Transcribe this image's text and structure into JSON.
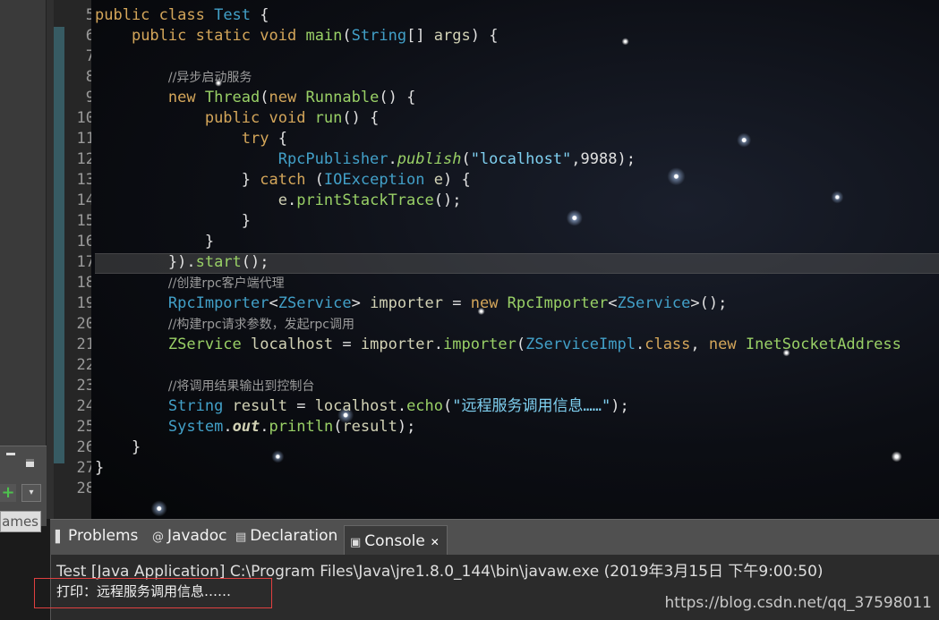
{
  "left_panel": {
    "names_tab": "ames"
  },
  "editor": {
    "line_numbers": [
      "5",
      "6",
      "7",
      "8",
      "9",
      "10",
      "11",
      "12",
      "13",
      "14",
      "15",
      "16",
      "17",
      "18",
      "19",
      "20",
      "21",
      "22",
      "23",
      "24",
      "25",
      "26",
      "27",
      "28"
    ],
    "lines": [
      [
        [
          "kw",
          "public "
        ],
        [
          "kw",
          "class "
        ],
        [
          "ty",
          "Test "
        ],
        [
          "p",
          "{"
        ]
      ],
      [
        [
          "p",
          "    "
        ],
        [
          "kw",
          "public "
        ],
        [
          "kw",
          "static "
        ],
        [
          "kw",
          "void "
        ],
        [
          "fn",
          "main"
        ],
        [
          "p",
          "("
        ],
        [
          "ty",
          "String"
        ],
        [
          "p",
          "[] "
        ],
        [
          "var",
          "args"
        ],
        [
          "p",
          ") {"
        ]
      ],
      [],
      [
        [
          "p",
          "        "
        ],
        [
          "cm",
          "//异步启动服务"
        ]
      ],
      [
        [
          "p",
          "        "
        ],
        [
          "kw",
          "new "
        ],
        [
          "cls",
          "Thread"
        ],
        [
          "p",
          "("
        ],
        [
          "kw",
          "new "
        ],
        [
          "cls",
          "Runnable"
        ],
        [
          "p",
          "() {"
        ]
      ],
      [
        [
          "p",
          "            "
        ],
        [
          "kw",
          "public "
        ],
        [
          "kw",
          "void "
        ],
        [
          "fn",
          "run"
        ],
        [
          "p",
          "() {"
        ]
      ],
      [
        [
          "p",
          "                "
        ],
        [
          "kw",
          "try "
        ],
        [
          "p",
          "{"
        ]
      ],
      [
        [
          "p",
          "                    "
        ],
        [
          "ty",
          "RpcPublisher"
        ],
        [
          "p",
          "."
        ],
        [
          "fn it",
          "publish"
        ],
        [
          "p",
          "("
        ],
        [
          "str",
          "\"localhost\""
        ],
        [
          "p",
          ",9988);"
        ]
      ],
      [
        [
          "p",
          "                "
        ],
        [
          "p",
          "} "
        ],
        [
          "kw",
          "catch "
        ],
        [
          "p",
          "("
        ],
        [
          "ty",
          "IOException "
        ],
        [
          "var",
          "e"
        ],
        [
          "p",
          ") {"
        ]
      ],
      [
        [
          "p",
          "                    "
        ],
        [
          "var",
          "e"
        ],
        [
          "p",
          "."
        ],
        [
          "fn",
          "printStackTrace"
        ],
        [
          "p",
          "();"
        ]
      ],
      [
        [
          "p",
          "                "
        ],
        [
          "p",
          "}"
        ]
      ],
      [
        [
          "p",
          "            "
        ],
        [
          "p",
          "}"
        ]
      ],
      [
        [
          "p",
          "        "
        ],
        [
          "p",
          "})."
        ],
        [
          "fn",
          "start"
        ],
        [
          "p",
          "();"
        ]
      ],
      [
        [
          "p",
          "        "
        ],
        [
          "cm",
          "//创建rpc客户端代理"
        ]
      ],
      [
        [
          "p",
          "        "
        ],
        [
          "ty",
          "RpcImporter"
        ],
        [
          "p",
          "<"
        ],
        [
          "ty",
          "ZService"
        ],
        [
          "p",
          "> "
        ],
        [
          "var",
          "importer "
        ],
        [
          "p",
          "= "
        ],
        [
          "kw",
          "new "
        ],
        [
          "cls",
          "RpcImporter"
        ],
        [
          "p",
          "<"
        ],
        [
          "ty",
          "ZService"
        ],
        [
          "p",
          ">();"
        ]
      ],
      [
        [
          "p",
          "        "
        ],
        [
          "cm",
          "//构建rpc请求参数，发起rpc调用"
        ]
      ],
      [
        [
          "p",
          "        "
        ],
        [
          "cls",
          "ZService "
        ],
        [
          "var",
          "localhost "
        ],
        [
          "p",
          "= "
        ],
        [
          "var",
          "importer"
        ],
        [
          "p",
          "."
        ],
        [
          "fn",
          "importer"
        ],
        [
          "p",
          "("
        ],
        [
          "ty",
          "ZServiceImpl"
        ],
        [
          "p",
          "."
        ],
        [
          "kw",
          "class"
        ],
        [
          "p",
          ", "
        ],
        [
          "kw",
          "new "
        ],
        [
          "cls",
          "InetSocketAddress"
        ]
      ],
      [],
      [
        [
          "p",
          "        "
        ],
        [
          "cm",
          "//将调用结果输出到控制台"
        ]
      ],
      [
        [
          "p",
          "        "
        ],
        [
          "ty",
          "String "
        ],
        [
          "var",
          "result "
        ],
        [
          "p",
          "= "
        ],
        [
          "var",
          "localhost"
        ],
        [
          "p",
          "."
        ],
        [
          "fn",
          "echo"
        ],
        [
          "p",
          "("
        ],
        [
          "str",
          "\"远程服务调用信息……\""
        ],
        [
          "p",
          ");"
        ]
      ],
      [
        [
          "p",
          "        "
        ],
        [
          "ty",
          "System"
        ],
        [
          "p",
          "."
        ],
        [
          "var it bold",
          "out"
        ],
        [
          "p",
          "."
        ],
        [
          "fn",
          "println"
        ],
        [
          "p",
          "("
        ],
        [
          "var",
          "result"
        ],
        [
          "p",
          ");"
        ]
      ],
      [
        [
          "p",
          "    "
        ],
        [
          "p",
          "}"
        ]
      ],
      [
        [
          "p",
          "}"
        ]
      ],
      []
    ]
  },
  "console": {
    "tabs": [
      {
        "icon": "problems-icon",
        "glyph": "▌",
        "label": "Problems"
      },
      {
        "icon": "javadoc-icon",
        "glyph": "@",
        "label": "Javadoc"
      },
      {
        "icon": "declaration-icon",
        "glyph": "▤",
        "label": "Declaration"
      },
      {
        "icon": "console-icon",
        "glyph": "▣",
        "label": "Console"
      }
    ],
    "close_glyph": "✕",
    "header": "Test [Java Application] C:\\Program Files\\Java\\jre1.8.0_144\\bin\\javaw.exe (2019年3月15日 下午9:00:50)",
    "output": "打印：远程服务调用信息……"
  },
  "watermark": "https://blog.csdn.net/qq_37598011"
}
